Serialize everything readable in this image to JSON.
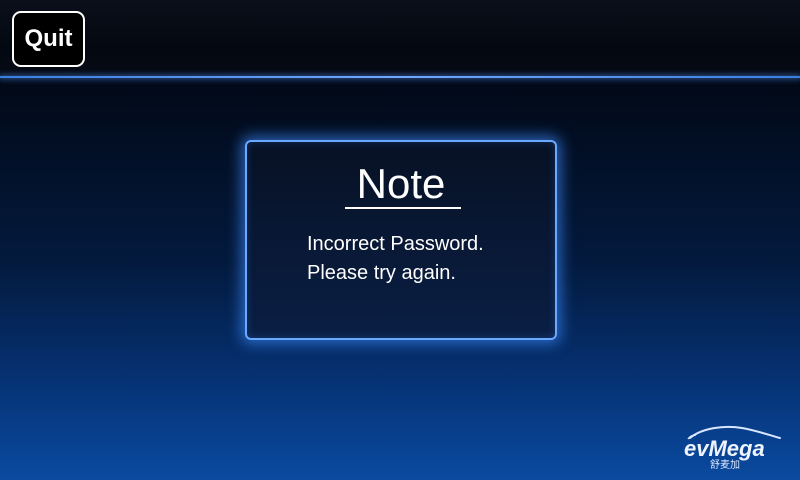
{
  "header": {
    "quit_label": "Quit"
  },
  "dialog": {
    "title": "Note",
    "message_line1": "Incorrect Password.",
    "message_line2": "Please try again."
  },
  "logo": {
    "brand": "evMega",
    "subtitle": "舒麦加"
  },
  "colors": {
    "accent": "#6aa9ff",
    "background_bottom": "#0a4aa0",
    "text": "#ffffff"
  }
}
